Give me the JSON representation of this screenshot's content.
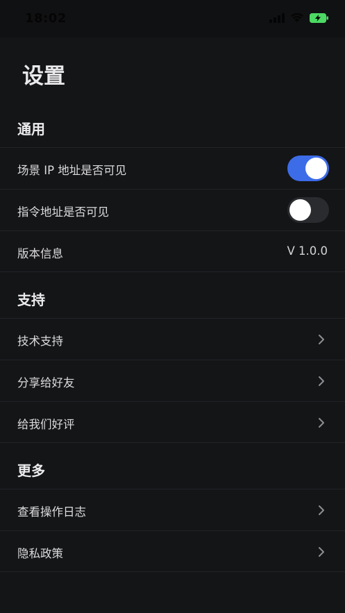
{
  "status_bar": {
    "time": "18:02",
    "icons": [
      "signal-icon",
      "wifi-icon",
      "battery-icon"
    ],
    "battery_color": "#4cd964"
  },
  "page": {
    "title": "设置"
  },
  "colors": {
    "background": "#141517",
    "toggle_on": "#3d6ce8",
    "toggle_off": "#2a2b2f"
  },
  "sections": {
    "general": {
      "header": "通用",
      "scene_ip": {
        "label": "场景 IP 地址是否可见",
        "toggle": "on"
      },
      "command_address": {
        "label": "指令地址是否可见",
        "toggle": "off"
      },
      "version": {
        "label": "版本信息",
        "value": "V 1.0.0"
      }
    },
    "support": {
      "header": "支持",
      "tech_support": {
        "label": "技术支持"
      },
      "share": {
        "label": "分享给好友"
      },
      "rate": {
        "label": "给我们好评"
      }
    },
    "more": {
      "header": "更多",
      "operation_log": {
        "label": "查看操作日志"
      },
      "privacy": {
        "label": "隐私政策"
      }
    }
  }
}
